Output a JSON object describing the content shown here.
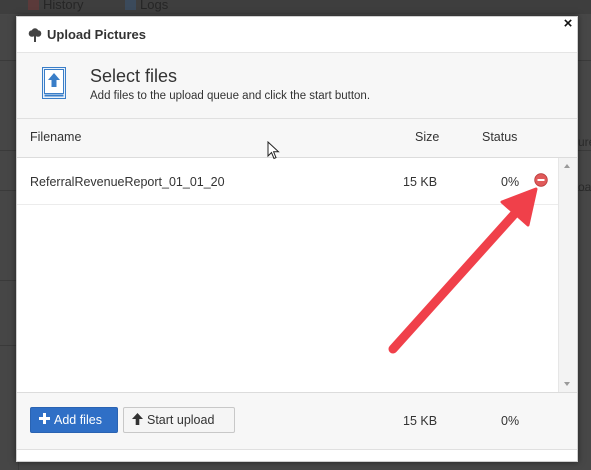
{
  "background": {
    "tabs": [
      {
        "label": "History"
      },
      {
        "label": "Logs"
      }
    ],
    "right_fragments": [
      "ure",
      "oa"
    ]
  },
  "dialog": {
    "title": "Upload Pictures",
    "title_icon": "tree-icon",
    "close_label": "×",
    "select": {
      "title": "Select files",
      "subtitle": "Add files to the upload queue and click the start button.",
      "icon": "upload-file-icon"
    },
    "columns": {
      "filename": "Filename",
      "size": "Size",
      "status": "Status"
    },
    "files": [
      {
        "name": "ReferralRevenueReport_01_01_20",
        "size": "15 KB",
        "status": "0%",
        "action_icon": "remove-icon"
      }
    ],
    "footer": {
      "add_files_label": "Add files",
      "start_upload_label": "Start upload",
      "total_size": "15 KB",
      "total_status": "0%"
    }
  },
  "colors": {
    "primary_button": "#2f6fc6",
    "remove_icon": "#e05a5a",
    "annotation_arrow": "#f0404a"
  }
}
